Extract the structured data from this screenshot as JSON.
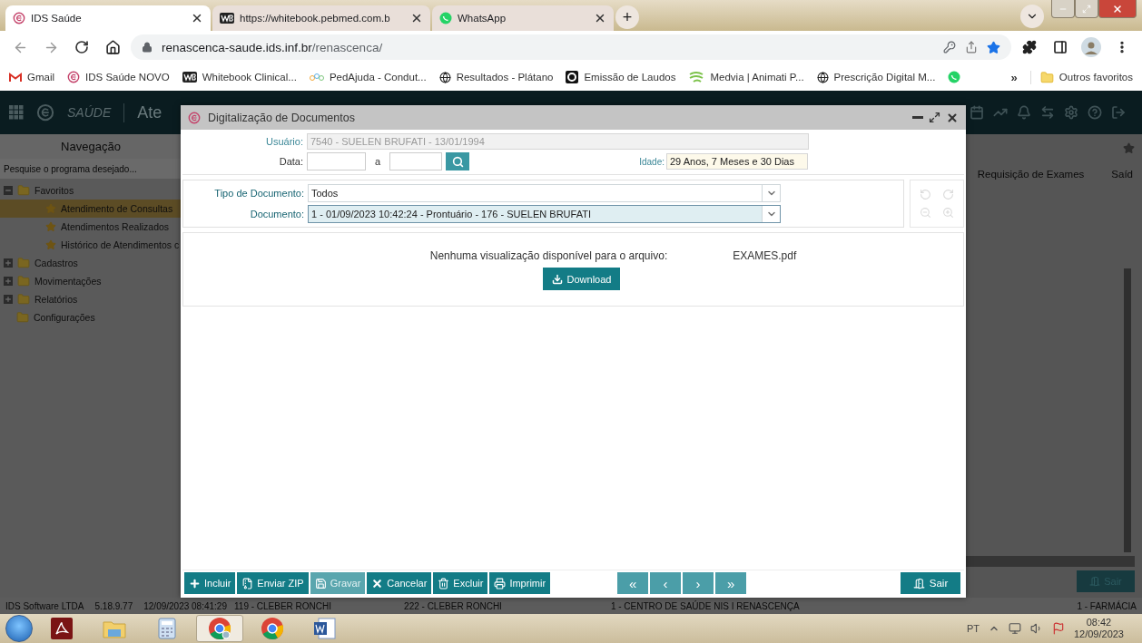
{
  "browser": {
    "tabs": [
      {
        "title": "IDS Saúde",
        "kind": "ids",
        "selected": true
      },
      {
        "title": "https://whitebook.pebmed.com.b",
        "kind": "wb",
        "selected": false
      },
      {
        "title": "WhatsApp",
        "kind": "whatsapp",
        "selected": false
      }
    ],
    "new_tab": "+",
    "address": {
      "host": "renascenca-saude.ids.inf.br",
      "path": "/renascenca/"
    },
    "bookmarks": [
      {
        "label": "Gmail",
        "kind": "gmail"
      },
      {
        "label": "IDS Saúde NOVO",
        "kind": "ids"
      },
      {
        "label": "Whitebook Clinical...",
        "kind": "wb"
      },
      {
        "label": "PedAjuda - Condut...",
        "kind": "dots"
      },
      {
        "label": "Resultados - Plátano",
        "kind": "globe"
      },
      {
        "label": "Emissão de Laudos",
        "kind": "ring"
      },
      {
        "label": "Medvia | Animati P...",
        "kind": "medvia"
      },
      {
        "label": "Prescrição Digital M...",
        "kind": "globe"
      },
      {
        "kind": "whatsapp"
      }
    ],
    "more_bookmarks": "»",
    "other_bookmarks": "Outros favoritos"
  },
  "app": {
    "brand": "SAÚDE",
    "title": "Ate",
    "navigation": {
      "title": "Navegação",
      "search_placeholder": "Pesquise o programa desejado...",
      "tree": [
        {
          "label": "Favoritos",
          "expanded": true,
          "children": [
            {
              "label": "Atendimento de Consultas",
              "selected": true
            },
            {
              "label": "Atendimentos Realizados",
              "selected": false
            },
            {
              "label": "Histórico de Atendimentos c",
              "selected": false
            }
          ]
        },
        {
          "label": "Cadastros",
          "expanded": false
        },
        {
          "label": "Movimentações",
          "expanded": false
        },
        {
          "label": "Relatórios",
          "expanded": false
        },
        {
          "label": "Configurações"
        }
      ]
    },
    "background_tabs": [
      "Requisição de Exames",
      "Saíd"
    ],
    "background_exit": "Sair"
  },
  "dialog": {
    "title": "Digitalização de Documentos",
    "user": {
      "label": "Usuário:",
      "value": "7540 - SUELEN BRUFATI - 13/01/1994",
      "disabled": true
    },
    "date": {
      "label": "Data:",
      "separator": "a"
    },
    "age": {
      "label": "Idade:",
      "value": "29 Anos, 7 Meses e 30 Dias"
    },
    "document_type": {
      "label": "Tipo de Documento:",
      "value": "Todos",
      "focused": false
    },
    "document": {
      "label": "Documento:",
      "value": "1 - 01/09/2023 10:42:24 - Prontuário - 176 - SUELEN BRUFATI",
      "focused": true
    },
    "viewer_tools_disabled": true,
    "preview": {
      "message": "Nenhuma visualização disponível para o arquivo:",
      "file": "EXAMES.pdf",
      "download": "Download"
    },
    "toolbar": [
      {
        "label": "Incluir",
        "kind": "plus",
        "disabled": false
      },
      {
        "label": "Enviar ZIP",
        "kind": "zip",
        "disabled": false
      },
      {
        "label": "Gravar",
        "kind": "save",
        "disabled": true
      },
      {
        "label": "Cancelar",
        "kind": "cancel",
        "disabled": false
      },
      {
        "label": "Excluir",
        "kind": "delete",
        "disabled": false
      },
      {
        "label": "Imprimir",
        "kind": "print",
        "disabled": false
      }
    ],
    "pager": [
      {
        "label": "«",
        "disabled": true
      },
      {
        "label": "‹",
        "disabled": true
      },
      {
        "label": "›",
        "disabled": true
      },
      {
        "label": "»",
        "disabled": true
      }
    ],
    "exit": "Sair"
  },
  "status_bar": [
    "IDS Software LTDA",
    "5.18.9.77",
    "12/09/2023 08:41:29",
    "119 - CLEBER RONCHI",
    "222 - CLEBER RONCHI",
    "1 - CENTRO DE SAÚDE NIS I RENASCENÇA",
    "1 - FARMÁCIA"
  ],
  "taskbar": {
    "apps": [
      {
        "kind": "acrobat",
        "selected": false
      },
      {
        "kind": "explorer",
        "selected": false
      },
      {
        "kind": "calculator",
        "selected": false
      },
      {
        "kind": "chrome-profile",
        "selected": true
      },
      {
        "kind": "chrome",
        "selected": false
      },
      {
        "kind": "word",
        "selected": false
      }
    ],
    "language": "PT",
    "time": "08:42",
    "date": "12/09/2023"
  }
}
